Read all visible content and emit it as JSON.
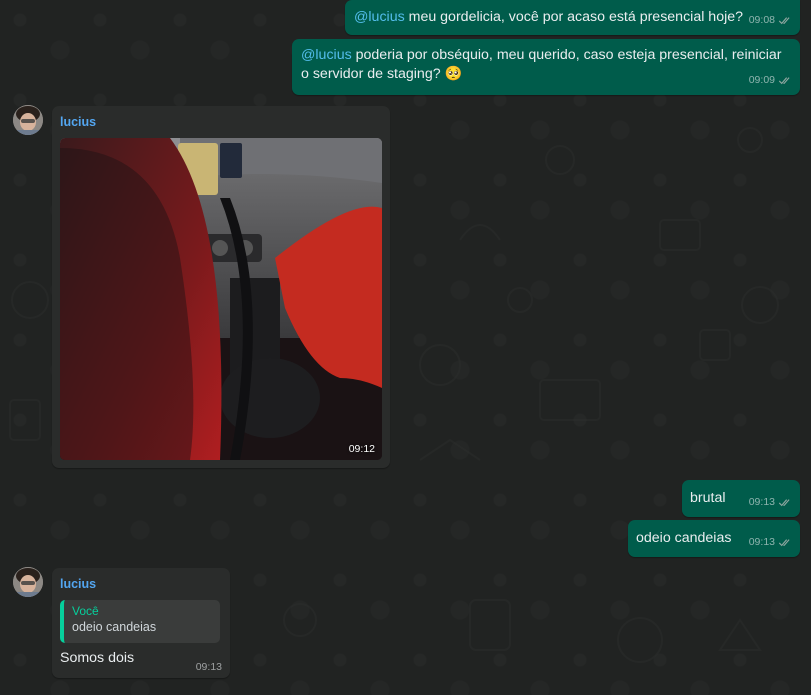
{
  "colors": {
    "outgoing_bubble": "#005c4b",
    "incoming_bubble": "#2a2c2b",
    "mention": "#53bdeb",
    "sender_name": "#53a6f0",
    "quote_accent": "#06cf9c"
  },
  "messages": [
    {
      "direction": "out",
      "mention": "@lucius",
      "text": " meu gordelicia, você por acaso está presencial hoje?",
      "time": "09:08",
      "status_icon": "double-check-icon"
    },
    {
      "direction": "out",
      "mention": "@lucius",
      "text": " poderia por obséquio, meu querido, caso esteja presencial, reiniciar o servidor de staging?",
      "emoji": "🥺",
      "time": "09:09",
      "status_icon": "double-check-icon"
    },
    {
      "direction": "in",
      "sender": "lucius",
      "type": "image",
      "time": "09:12"
    },
    {
      "direction": "out",
      "text": "brutal",
      "time": "09:13",
      "status_icon": "double-check-icon"
    },
    {
      "direction": "out",
      "text": "odeio candeias",
      "time": "09:13",
      "status_icon": "double-check-icon"
    },
    {
      "direction": "in",
      "sender": "lucius",
      "quote": {
        "author": "Você",
        "text": "odeio candeias"
      },
      "text": "Somos dois",
      "time": "09:13"
    }
  ]
}
